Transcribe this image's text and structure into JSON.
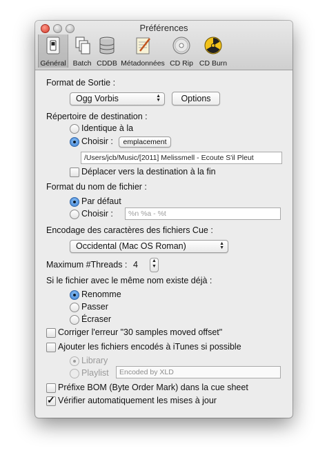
{
  "window": {
    "title": "Préférences"
  },
  "toolbar": {
    "items": [
      {
        "label": "Général",
        "icon": "general-switch-icon"
      },
      {
        "label": "Batch",
        "icon": "batch-documents-icon"
      },
      {
        "label": "CDDB",
        "icon": "database-icon"
      },
      {
        "label": "Métadonnées",
        "icon": "metadata-notepad-icon"
      },
      {
        "label": "CD Rip",
        "icon": "cd-disc-icon"
      },
      {
        "label": "CD Burn",
        "icon": "radiation-burn-icon"
      }
    ]
  },
  "output": {
    "heading": "Format de Sortie :",
    "format_value": "Ogg Vorbis",
    "options_button": "Options"
  },
  "destination": {
    "heading": "Répertoire de destination :",
    "same_label": "Identique à la",
    "choose_label": "Choisir :",
    "location_button": "emplacement",
    "path": "/Users/jcb/Music/[2011] Melissmell - Ecoute S'il Pleut",
    "move_label": "Déplacer vers la destination à la fin"
  },
  "filename": {
    "heading": "Format du nom de fichier :",
    "default_label": "Par défaut",
    "choose_label": "Choisir :",
    "pattern_placeholder": "%n %a - %t"
  },
  "cue": {
    "heading": "Encodage des caractères des fichiers Cue :",
    "encoding_value": "Occidental (Mac OS Roman)"
  },
  "threads": {
    "label": "Maximum #Threads :",
    "value": "4"
  },
  "conflict": {
    "heading": "Si le fichier avec le même nom existe déjà :",
    "rename_label": "Renomme",
    "skip_label": "Passer",
    "overwrite_label": "Écraser"
  },
  "options": {
    "fix_offset_label": "Corriger l'erreur \"30 samples moved offset\"",
    "itunes_label": "Ajouter les fichiers encodés à iTunes si possible",
    "library_label": "Library",
    "playlist_label": "Playlist",
    "playlist_value": "Encoded by XLD",
    "bom_label": "Préfixe BOM (Byte Order Mark) dans la cue sheet",
    "updates_label": "Vérifier automatiquement les mises à jour"
  },
  "state": {
    "selected_tab": "Général",
    "destination_mode": "Choisir",
    "filename_mode": "Par défaut",
    "conflict_mode": "Renomme",
    "playlist_mode": "Library",
    "move_checked": false,
    "fix_offset_checked": false,
    "itunes_checked": false,
    "bom_checked": false,
    "updates_checked": true
  },
  "colors": {
    "accent_radio": "#3a7fd3",
    "window_bg": "#ececec",
    "close_button": "#d3392a"
  }
}
